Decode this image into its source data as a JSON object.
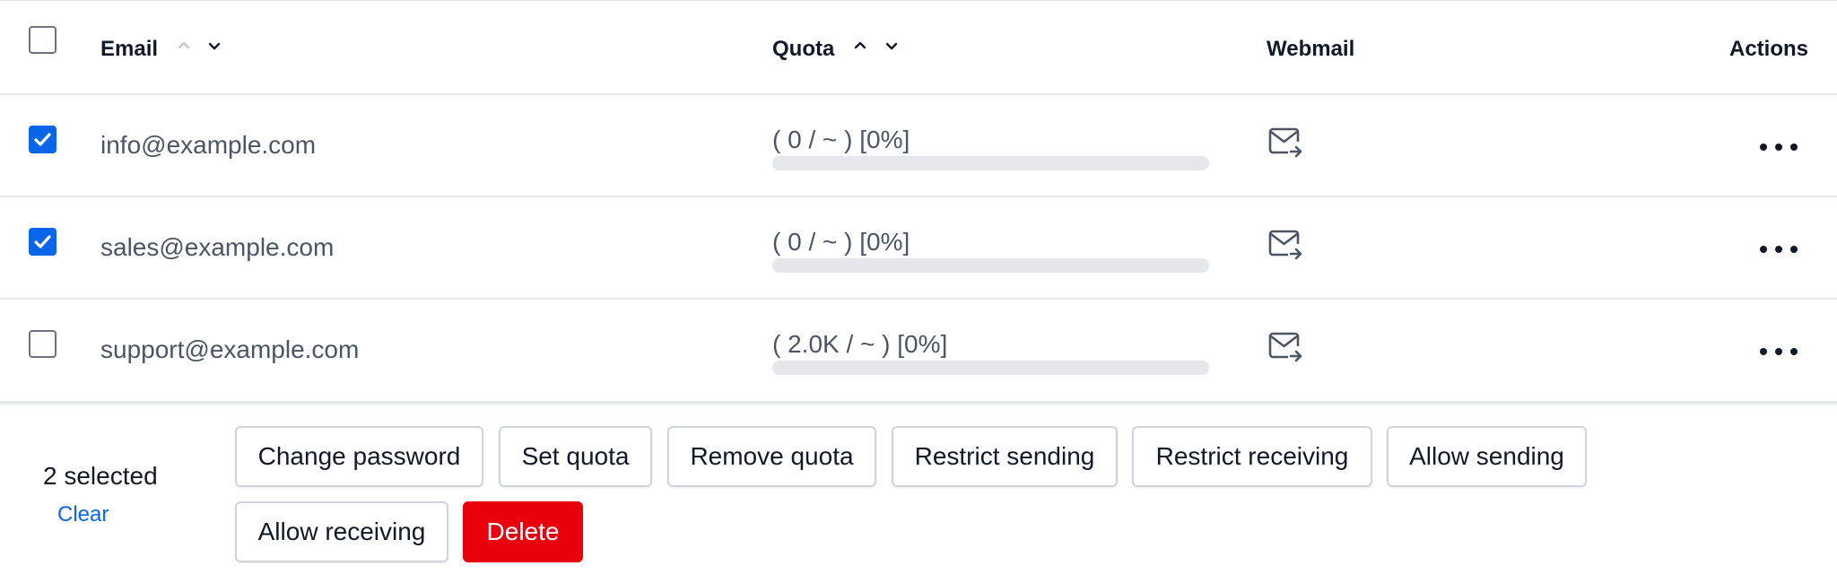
{
  "columns": {
    "email": "Email",
    "quota": "Quota",
    "webmail": "Webmail",
    "actions": "Actions"
  },
  "rows": [
    {
      "email": "info@example.com",
      "quota_text": "( 0 / ~ ) [0%]",
      "quota_percent": 0,
      "checked": true
    },
    {
      "email": "sales@example.com",
      "quota_text": "( 0 / ~ ) [0%]",
      "quota_percent": 0,
      "checked": true
    },
    {
      "email": "support@example.com",
      "quota_text": "( 2.0K / ~ ) [0%]",
      "quota_percent": 0,
      "checked": false
    }
  ],
  "selection": {
    "count_text": "2 selected",
    "clear_label": "Clear"
  },
  "bulk_actions": {
    "change_password": "Change password",
    "set_quota": "Set quota",
    "remove_quota": "Remove quota",
    "restrict_sending": "Restrict sending",
    "restrict_receiving": "Restrict receiving",
    "allow_sending": "Allow sending",
    "allow_receiving": "Allow receiving",
    "delete": "Delete"
  },
  "colors": {
    "accent": "#0a66e8",
    "danger": "#e8000d",
    "border": "#e5e7eb"
  }
}
